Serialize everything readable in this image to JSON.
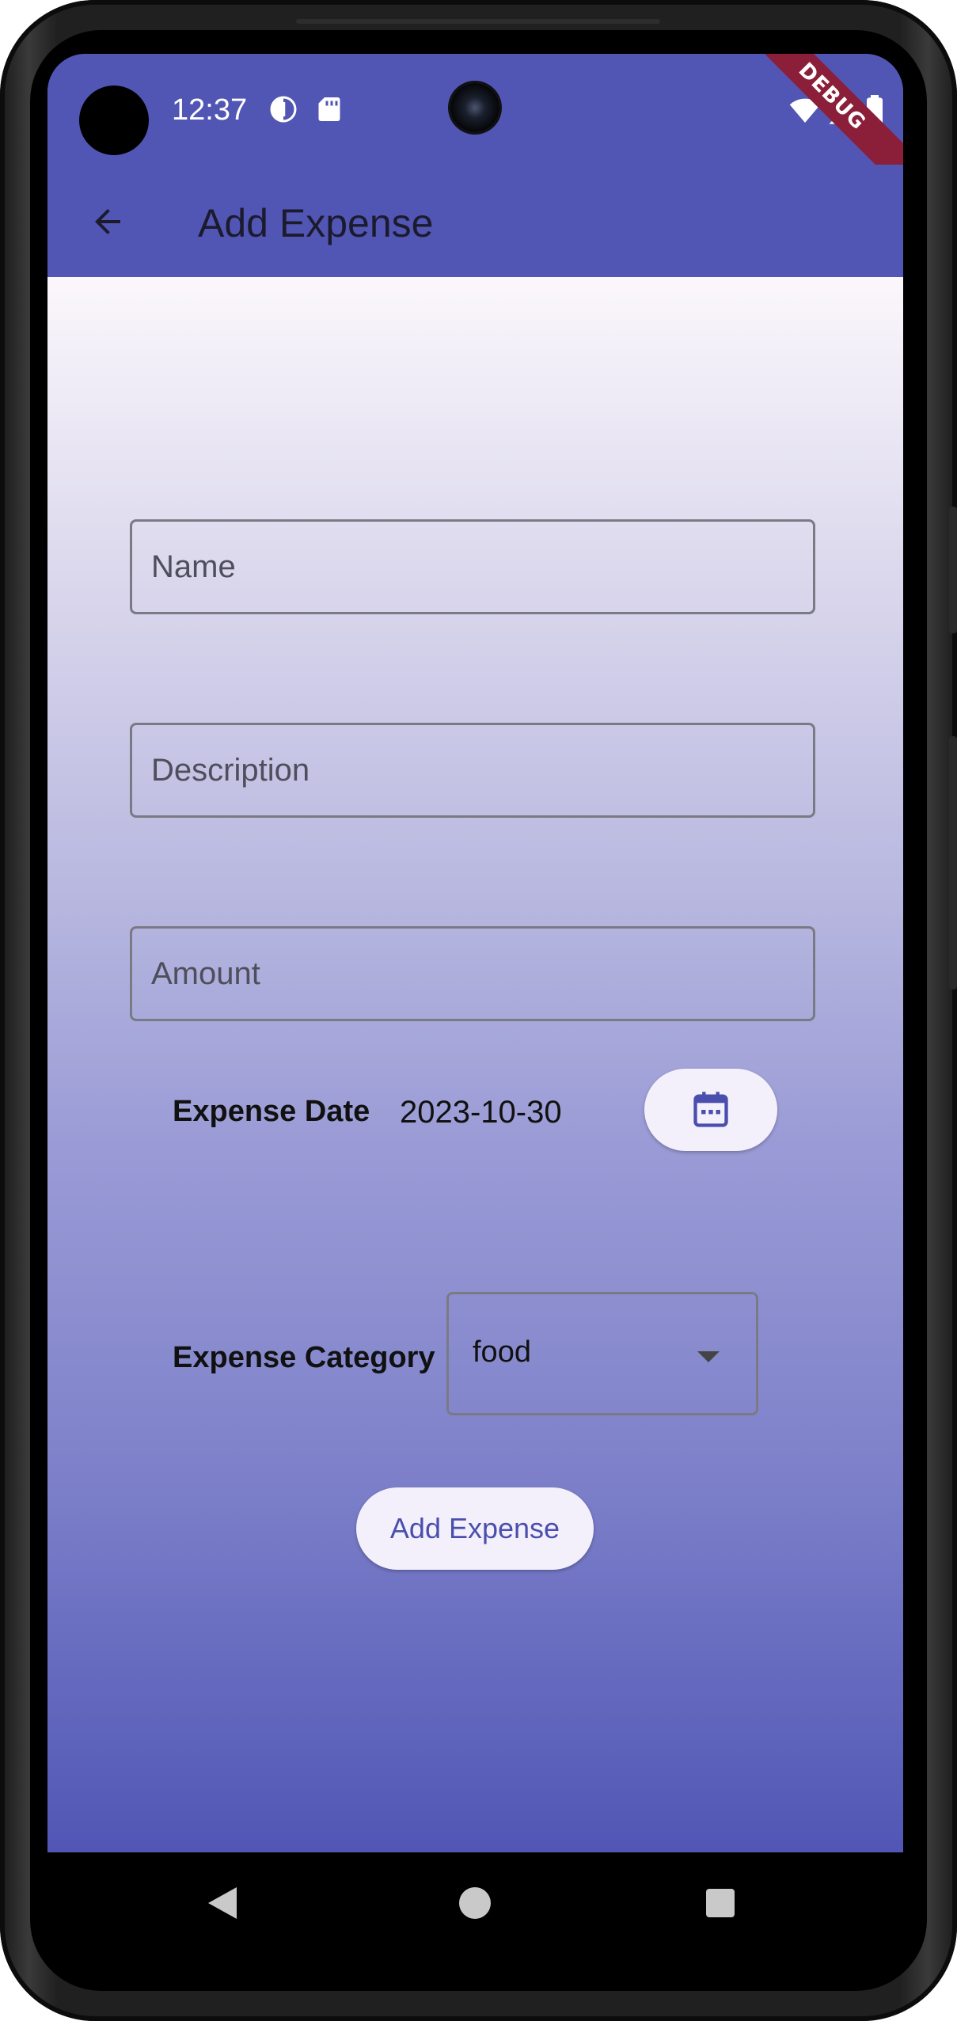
{
  "status_bar": {
    "time": "12:37",
    "icons": [
      "pinwheel-icon",
      "sd-card-icon",
      "wifi-icon",
      "signal-icon",
      "battery-icon"
    ],
    "debug_banner": "DEBUG"
  },
  "app_bar": {
    "title": "Add Expense",
    "back_icon": "arrow-back-icon"
  },
  "form": {
    "name_placeholder": "Name",
    "description_placeholder": "Description",
    "amount_placeholder": "Amount",
    "date_label": "Expense Date",
    "date_value": "2023-10-30",
    "calendar_icon": "calendar-icon",
    "category_label": "Expense Category",
    "category_value": "food",
    "submit_label": "Add Expense"
  },
  "colors": {
    "primary": "#5156b5",
    "button_bg": "#f4f0fb",
    "button_text": "#4a4fae",
    "debug_ribbon": "#8b1f3a"
  },
  "nav_bar": {
    "icons": [
      "nav-back-icon",
      "nav-home-icon",
      "nav-recents-icon"
    ]
  }
}
